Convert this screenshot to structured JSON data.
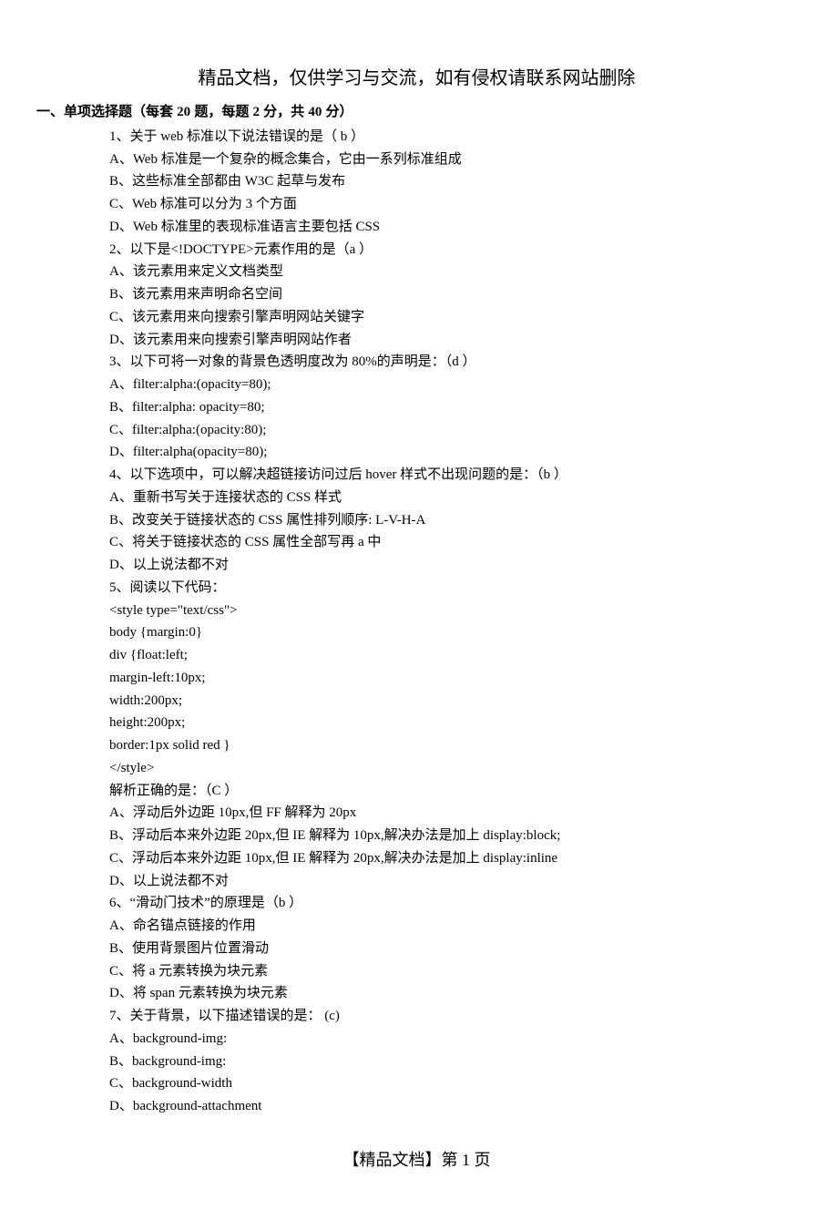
{
  "header": {
    "notice": "精品文档，仅供学习与交流，如有侵权请联系网站删除"
  },
  "section": {
    "prefix": "一、单项选择题（每套 ",
    "n1": "20",
    "mid1": " 题，每题 ",
    "n2": "2",
    "mid2": " 分，共 ",
    "n3": "40",
    "suffix": " 分）"
  },
  "lines": {
    "l0": "1、关于 web 标准以下说法错误的是（ b ）",
    "l1": "A、Web 标准是一个复杂的概念集合，它由一系列标准组成",
    "l2": "B、这些标准全部都由 W3C 起草与发布",
    "l3": "C、Web 标准可以分为 3 个方面",
    "l4": "D、Web 标准里的表现标准语言主要包括 CSS",
    "l5": "2、以下是<!DOCTYPE>元素作用的是（a ）",
    "l6": "A、该元素用来定义文档类型",
    "l7": "B、该元素用来声明命名空间",
    "l8": "C、该元素用来向搜索引擎声明网站关键字",
    "l9": "D、该元素用来向搜索引擎声明网站作者",
    "l10": "3、以下可将一对象的背景色透明度改为 80%的声明是：（d ）",
    "l11": "A、filter:alpha:(opacity=80);",
    "l12": "B、filter:alpha: opacity=80;",
    "l13": "C、filter:alpha:(opacity:80);",
    "l14": "D、filter:alpha(opacity=80);",
    "l15": "4、以下选项中，可以解决超链接访问过后 hover 样式不出现问题的是：（b ）",
    "l16": "A、重新书写关于连接状态的 CSS 样式",
    "l17": "B、改变关于链接状态的 CSS 属性排列顺序: L-V-H-A",
    "l18": "C、将关于链接状态的 CSS 属性全部写再 a 中",
    "l19": "D、以上说法都不对",
    "l20": "5、阅读以下代码：",
    "l21": "<style type=\"text/css\">",
    "l22": "            body {margin:0}",
    "l23": "            div {float:left;",
    "l24": "  margin-left:10px;",
    "l25": "width:200px;",
    "l26": "height:200px;",
    "l27": "border:1px solid red }",
    "l28": "       </style>",
    "l29": "解析正确的是：（C ）",
    "l30": "A、浮动后外边距 10px,但 FF 解释为 20px",
    "l31": "B、浮动后本来外边距 20px,但 IE 解释为 10px,解决办法是加上 display:block;",
    "l32": "C、浮动后本来外边距 10px,但 IE 解释为 20px,解决办法是加上 display:inline",
    "l33": "D、以上说法都不对",
    "l34": "6、“滑动门技术”的原理是（b ）",
    "l35": "A、命名锚点链接的作用",
    "l36": "B、使用背景图片位置滑动",
    "l37": "C、将 a 元素转换为块元素",
    "l38": "D、将 span 元素转换为块元素",
    "l39": "7、关于背景，以下描述错误的是：    (c)",
    "l40": "A、background-img:",
    "l41": "B、background-img:",
    "l42": "C、background-width",
    "l43": "D、background-attachment"
  },
  "footer": {
    "text": "【精品文档】第 1 页"
  }
}
